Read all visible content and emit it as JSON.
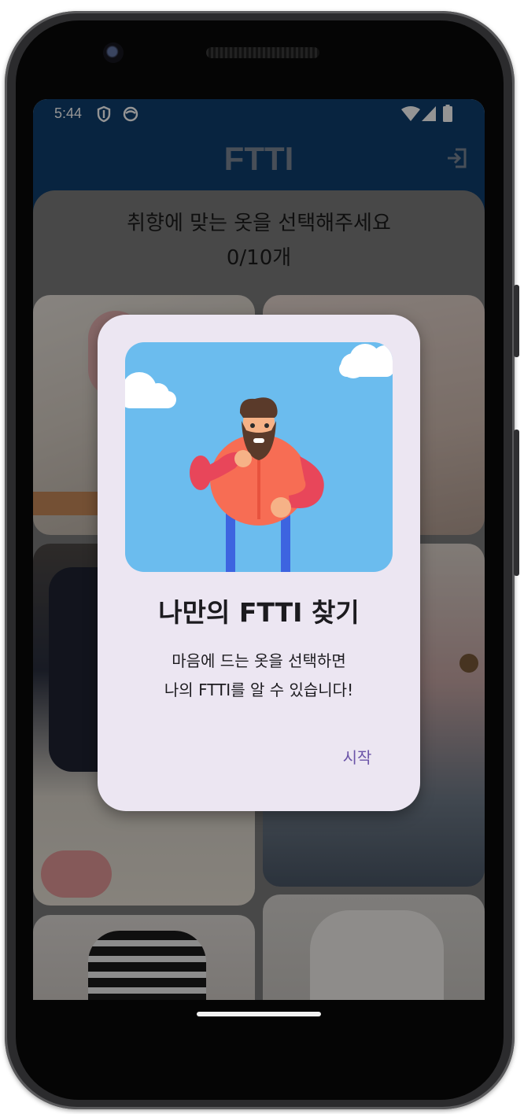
{
  "status_bar": {
    "time": "5:44"
  },
  "app_bar": {
    "title": "FTTI"
  },
  "selection": {
    "instruction": "취향에 맞는 옷을 선택해주세요",
    "counter": "0/10개"
  },
  "dialog": {
    "title": "나만의 FTTI 찾기",
    "message_line1": "마음에 드는 옷을 선택하면",
    "message_line2": "나의 FTTI를 알 수 있습니다!",
    "start_button": "시작"
  },
  "colors": {
    "app_bar": "#0e3e6e",
    "dialog_bg": "#ece6f2",
    "accent": "#6b54a8",
    "sky": "#6bbcee"
  },
  "icons": [
    "shield-icon",
    "notification-face-icon",
    "wifi-icon",
    "signal-icon",
    "battery-icon",
    "exit-icon"
  ]
}
